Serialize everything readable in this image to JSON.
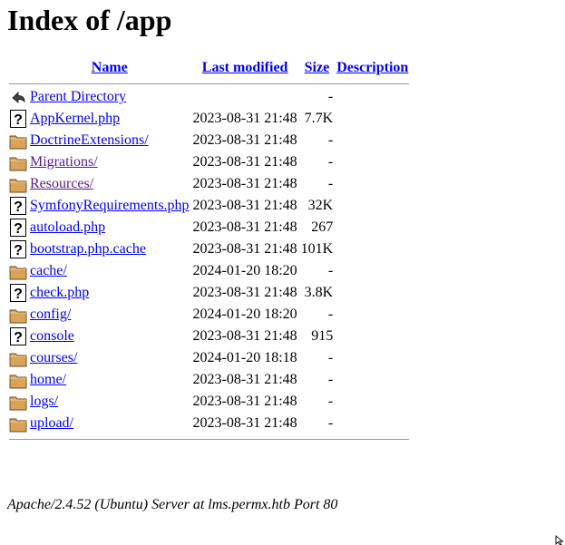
{
  "page": {
    "title": "Index of /app",
    "footer": "Apache/2.4.52 (Ubuntu) Server at lms.permx.htb Port 80"
  },
  "columns": {
    "name": "Name",
    "modified": "Last modified",
    "size": "Size",
    "description": "Description"
  },
  "parent": {
    "label": "Parent Directory",
    "size": "-"
  },
  "entries": [
    {
      "name": "AppKernel.php",
      "modified": "2023-08-31 21:48",
      "size": "7.7K",
      "icon": "unknown-file-icon",
      "visited": false
    },
    {
      "name": "DoctrineExtensions/",
      "modified": "2023-08-31 21:48",
      "size": "-",
      "icon": "folder-icon",
      "visited": false
    },
    {
      "name": "Migrations/",
      "modified": "2023-08-31 21:48",
      "size": "-",
      "icon": "folder-icon",
      "visited": true
    },
    {
      "name": "Resources/",
      "modified": "2023-08-31 21:48",
      "size": "-",
      "icon": "folder-icon",
      "visited": true
    },
    {
      "name": "SymfonyRequirements.php",
      "modified": "2023-08-31 21:48",
      "size": "32K",
      "icon": "unknown-file-icon",
      "visited": false
    },
    {
      "name": "autoload.php",
      "modified": "2023-08-31 21:48",
      "size": "267",
      "icon": "unknown-file-icon",
      "visited": false
    },
    {
      "name": "bootstrap.php.cache",
      "modified": "2023-08-31 21:48",
      "size": "101K",
      "icon": "unknown-file-icon",
      "visited": false
    },
    {
      "name": "cache/",
      "modified": "2024-01-20 18:20",
      "size": "-",
      "icon": "folder-icon",
      "visited": false
    },
    {
      "name": "check.php",
      "modified": "2023-08-31 21:48",
      "size": "3.8K",
      "icon": "unknown-file-icon",
      "visited": false
    },
    {
      "name": "config/",
      "modified": "2024-01-20 18:20",
      "size": "-",
      "icon": "folder-icon",
      "visited": false
    },
    {
      "name": "console",
      "modified": "2023-08-31 21:48",
      "size": "915",
      "icon": "unknown-file-icon",
      "visited": false
    },
    {
      "name": "courses/",
      "modified": "2024-01-20 18:18",
      "size": "-",
      "icon": "folder-icon",
      "visited": false
    },
    {
      "name": "home/",
      "modified": "2023-08-31 21:48",
      "size": "-",
      "icon": "folder-icon",
      "visited": false
    },
    {
      "name": "logs/",
      "modified": "2023-08-31 21:48",
      "size": "-",
      "icon": "folder-icon",
      "visited": false
    },
    {
      "name": "upload/",
      "modified": "2023-08-31 21:48",
      "size": "-",
      "icon": "folder-icon",
      "visited": false
    }
  ],
  "colors": {
    "link": "#0000ee",
    "visited": "#551a8b",
    "folder": "#d9a35a",
    "rule": "#999999"
  }
}
